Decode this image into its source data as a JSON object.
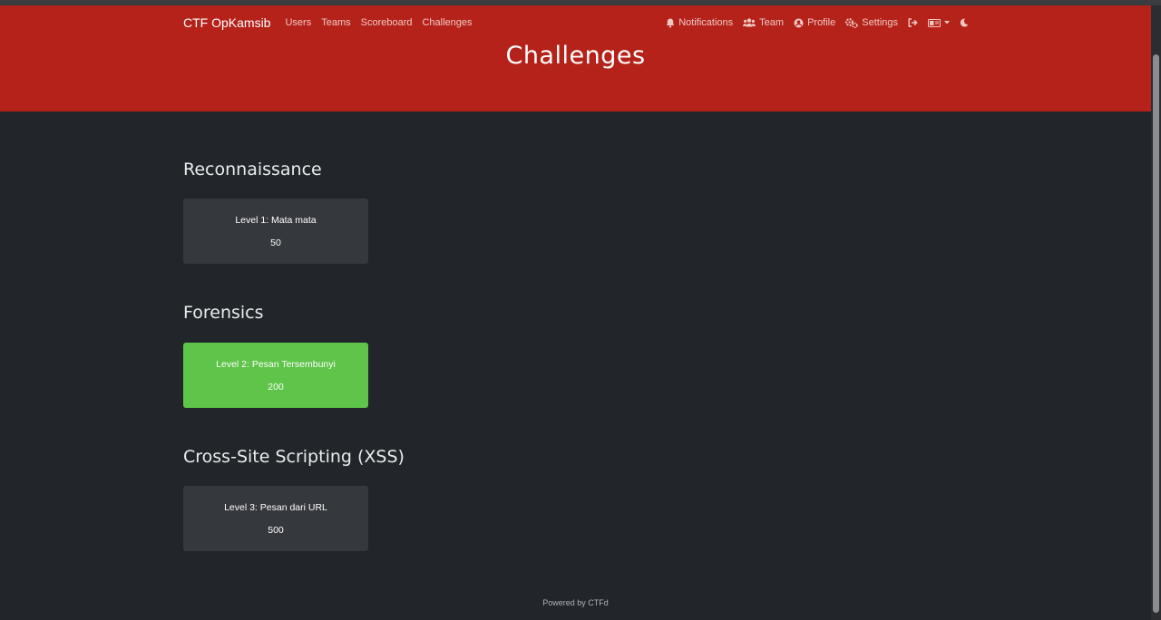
{
  "navbar": {
    "brand": "CTF OpKamsib",
    "links": [
      "Users",
      "Teams",
      "Scoreboard",
      "Challenges"
    ],
    "right": {
      "notifications": "Notifications",
      "team": "Team",
      "profile": "Profile",
      "settings": "Settings"
    }
  },
  "page": {
    "title": "Challenges"
  },
  "categories": [
    {
      "name": "Reconnaissance",
      "challenges": [
        {
          "name": "Level 1: Mata mata",
          "value": "50",
          "solved": false
        }
      ]
    },
    {
      "name": "Forensics",
      "challenges": [
        {
          "name": "Level 2: Pesan Tersembunyi",
          "value": "200",
          "solved": true
        }
      ]
    },
    {
      "name": "Cross-Site Scripting (XSS)",
      "challenges": [
        {
          "name": "Level 3: Pesan dari URL",
          "value": "500",
          "solved": false
        }
      ]
    }
  ],
  "footer": {
    "text": "Powered by CTFd"
  },
  "colors": {
    "header": "#b4221a",
    "background": "#222529",
    "card": "#35383d",
    "solved": "#5ec44a"
  }
}
